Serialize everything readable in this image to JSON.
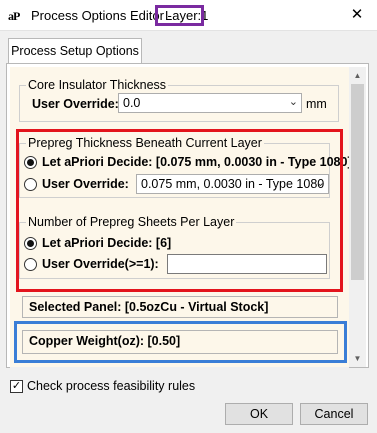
{
  "window": {
    "app_icon": "aP",
    "title": "Process Options Editor - ",
    "layer_label": "Layer:1",
    "close_icon": "✕"
  },
  "tabs": [
    {
      "label": "Process Setup Options"
    }
  ],
  "core_insulator": {
    "legend": "Core Insulator Thickness",
    "override_label": "User Override:",
    "override_value": "0.0",
    "unit": "mm"
  },
  "prepreg_thickness": {
    "legend": "Prepreg Thickness Beneath Current Layer",
    "apriori_label": "Let aPriori Decide: [0.075 mm, 0.0030 in - Type 1080]",
    "override_label": "User Override:",
    "override_value": "0.075 mm, 0.0030 in - Type 1080"
  },
  "prepreg_sheets": {
    "legend": "Number of Prepreg Sheets Per Layer",
    "apriori_label": "Let aPriori Decide: [6]",
    "override_label": "User Override(>=1):",
    "override_value": ""
  },
  "selected_panel": "Selected Panel: [0.5ozCu - Virtual Stock]",
  "copper_weight": "Copper Weight(oz): [0.50]",
  "feasibility": {
    "label": "Check process feasibility rules",
    "checked": true
  },
  "buttons": {
    "ok": "OK",
    "cancel": "Cancel"
  },
  "highlight_colors": {
    "title_box": "#7a2aa0",
    "prepreg_box": "#e3141c",
    "copper_box": "#3b7ed6"
  }
}
